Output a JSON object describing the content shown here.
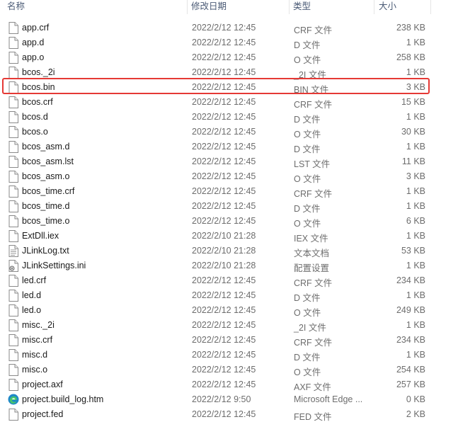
{
  "columns": {
    "name": "名称",
    "date": "修改日期",
    "type": "类型",
    "size": "大小"
  },
  "files": [
    {
      "name": "app.crf",
      "date": "2022/2/12 12:45",
      "type": "CRF 文件",
      "size": "238 KB",
      "icon": "file-icon"
    },
    {
      "name": "app.d",
      "date": "2022/2/12 12:45",
      "type": "D 文件",
      "size": "1 KB",
      "icon": "file-icon"
    },
    {
      "name": "app.o",
      "date": "2022/2/12 12:45",
      "type": "O 文件",
      "size": "258 KB",
      "icon": "file-icon"
    },
    {
      "name": "bcos._2i",
      "date": "2022/2/12 12:45",
      "type": "_2I 文件",
      "size": "1 KB",
      "icon": "file-icon"
    },
    {
      "name": "bcos.bin",
      "date": "2022/2/12 12:45",
      "type": "BIN 文件",
      "size": "3 KB",
      "icon": "file-icon"
    },
    {
      "name": "bcos.crf",
      "date": "2022/2/12 12:45",
      "type": "CRF 文件",
      "size": "15 KB",
      "icon": "file-icon"
    },
    {
      "name": "bcos.d",
      "date": "2022/2/12 12:45",
      "type": "D 文件",
      "size": "1 KB",
      "icon": "file-icon"
    },
    {
      "name": "bcos.o",
      "date": "2022/2/12 12:45",
      "type": "O 文件",
      "size": "30 KB",
      "icon": "file-icon"
    },
    {
      "name": "bcos_asm.d",
      "date": "2022/2/12 12:45",
      "type": "D 文件",
      "size": "1 KB",
      "icon": "file-icon"
    },
    {
      "name": "bcos_asm.lst",
      "date": "2022/2/12 12:45",
      "type": "LST 文件",
      "size": "11 KB",
      "icon": "file-icon"
    },
    {
      "name": "bcos_asm.o",
      "date": "2022/2/12 12:45",
      "type": "O 文件",
      "size": "3 KB",
      "icon": "file-icon"
    },
    {
      "name": "bcos_time.crf",
      "date": "2022/2/12 12:45",
      "type": "CRF 文件",
      "size": "1 KB",
      "icon": "file-icon"
    },
    {
      "name": "bcos_time.d",
      "date": "2022/2/12 12:45",
      "type": "D 文件",
      "size": "1 KB",
      "icon": "file-icon"
    },
    {
      "name": "bcos_time.o",
      "date": "2022/2/12 12:45",
      "type": "O 文件",
      "size": "6 KB",
      "icon": "file-icon"
    },
    {
      "name": "ExtDll.iex",
      "date": "2022/2/10 21:28",
      "type": "IEX 文件",
      "size": "1 KB",
      "icon": "file-icon"
    },
    {
      "name": "JLinkLog.txt",
      "date": "2022/2/10 21:28",
      "type": "文本文档",
      "size": "53 KB",
      "icon": "text-file-icon"
    },
    {
      "name": "JLinkSettings.ini",
      "date": "2022/2/10 21:28",
      "type": "配置设置",
      "size": "1 KB",
      "icon": "settings-file-icon"
    },
    {
      "name": "led.crf",
      "date": "2022/2/12 12:45",
      "type": "CRF 文件",
      "size": "234 KB",
      "icon": "file-icon"
    },
    {
      "name": "led.d",
      "date": "2022/2/12 12:45",
      "type": "D 文件",
      "size": "1 KB",
      "icon": "file-icon"
    },
    {
      "name": "led.o",
      "date": "2022/2/12 12:45",
      "type": "O 文件",
      "size": "249 KB",
      "icon": "file-icon"
    },
    {
      "name": "misc._2i",
      "date": "2022/2/12 12:45",
      "type": "_2I 文件",
      "size": "1 KB",
      "icon": "file-icon"
    },
    {
      "name": "misc.crf",
      "date": "2022/2/12 12:45",
      "type": "CRF 文件",
      "size": "234 KB",
      "icon": "file-icon"
    },
    {
      "name": "misc.d",
      "date": "2022/2/12 12:45",
      "type": "D 文件",
      "size": "1 KB",
      "icon": "file-icon"
    },
    {
      "name": "misc.o",
      "date": "2022/2/12 12:45",
      "type": "O 文件",
      "size": "254 KB",
      "icon": "file-icon"
    },
    {
      "name": "project.axf",
      "date": "2022/2/12 12:45",
      "type": "AXF 文件",
      "size": "257 KB",
      "icon": "file-icon"
    },
    {
      "name": "project.build_log.htm",
      "date": "2022/2/12 9:50",
      "type": "Microsoft Edge ...",
      "size": "0 KB",
      "icon": "edge-icon"
    },
    {
      "name": "project.fed",
      "date": "2022/2/12 12:45",
      "type": "FED 文件",
      "size": "2 KB",
      "icon": "file-icon"
    }
  ],
  "highlighted_file": "bcos.bin",
  "colors": {
    "highlight": "#e53935",
    "header_text": "#4a5a75"
  }
}
